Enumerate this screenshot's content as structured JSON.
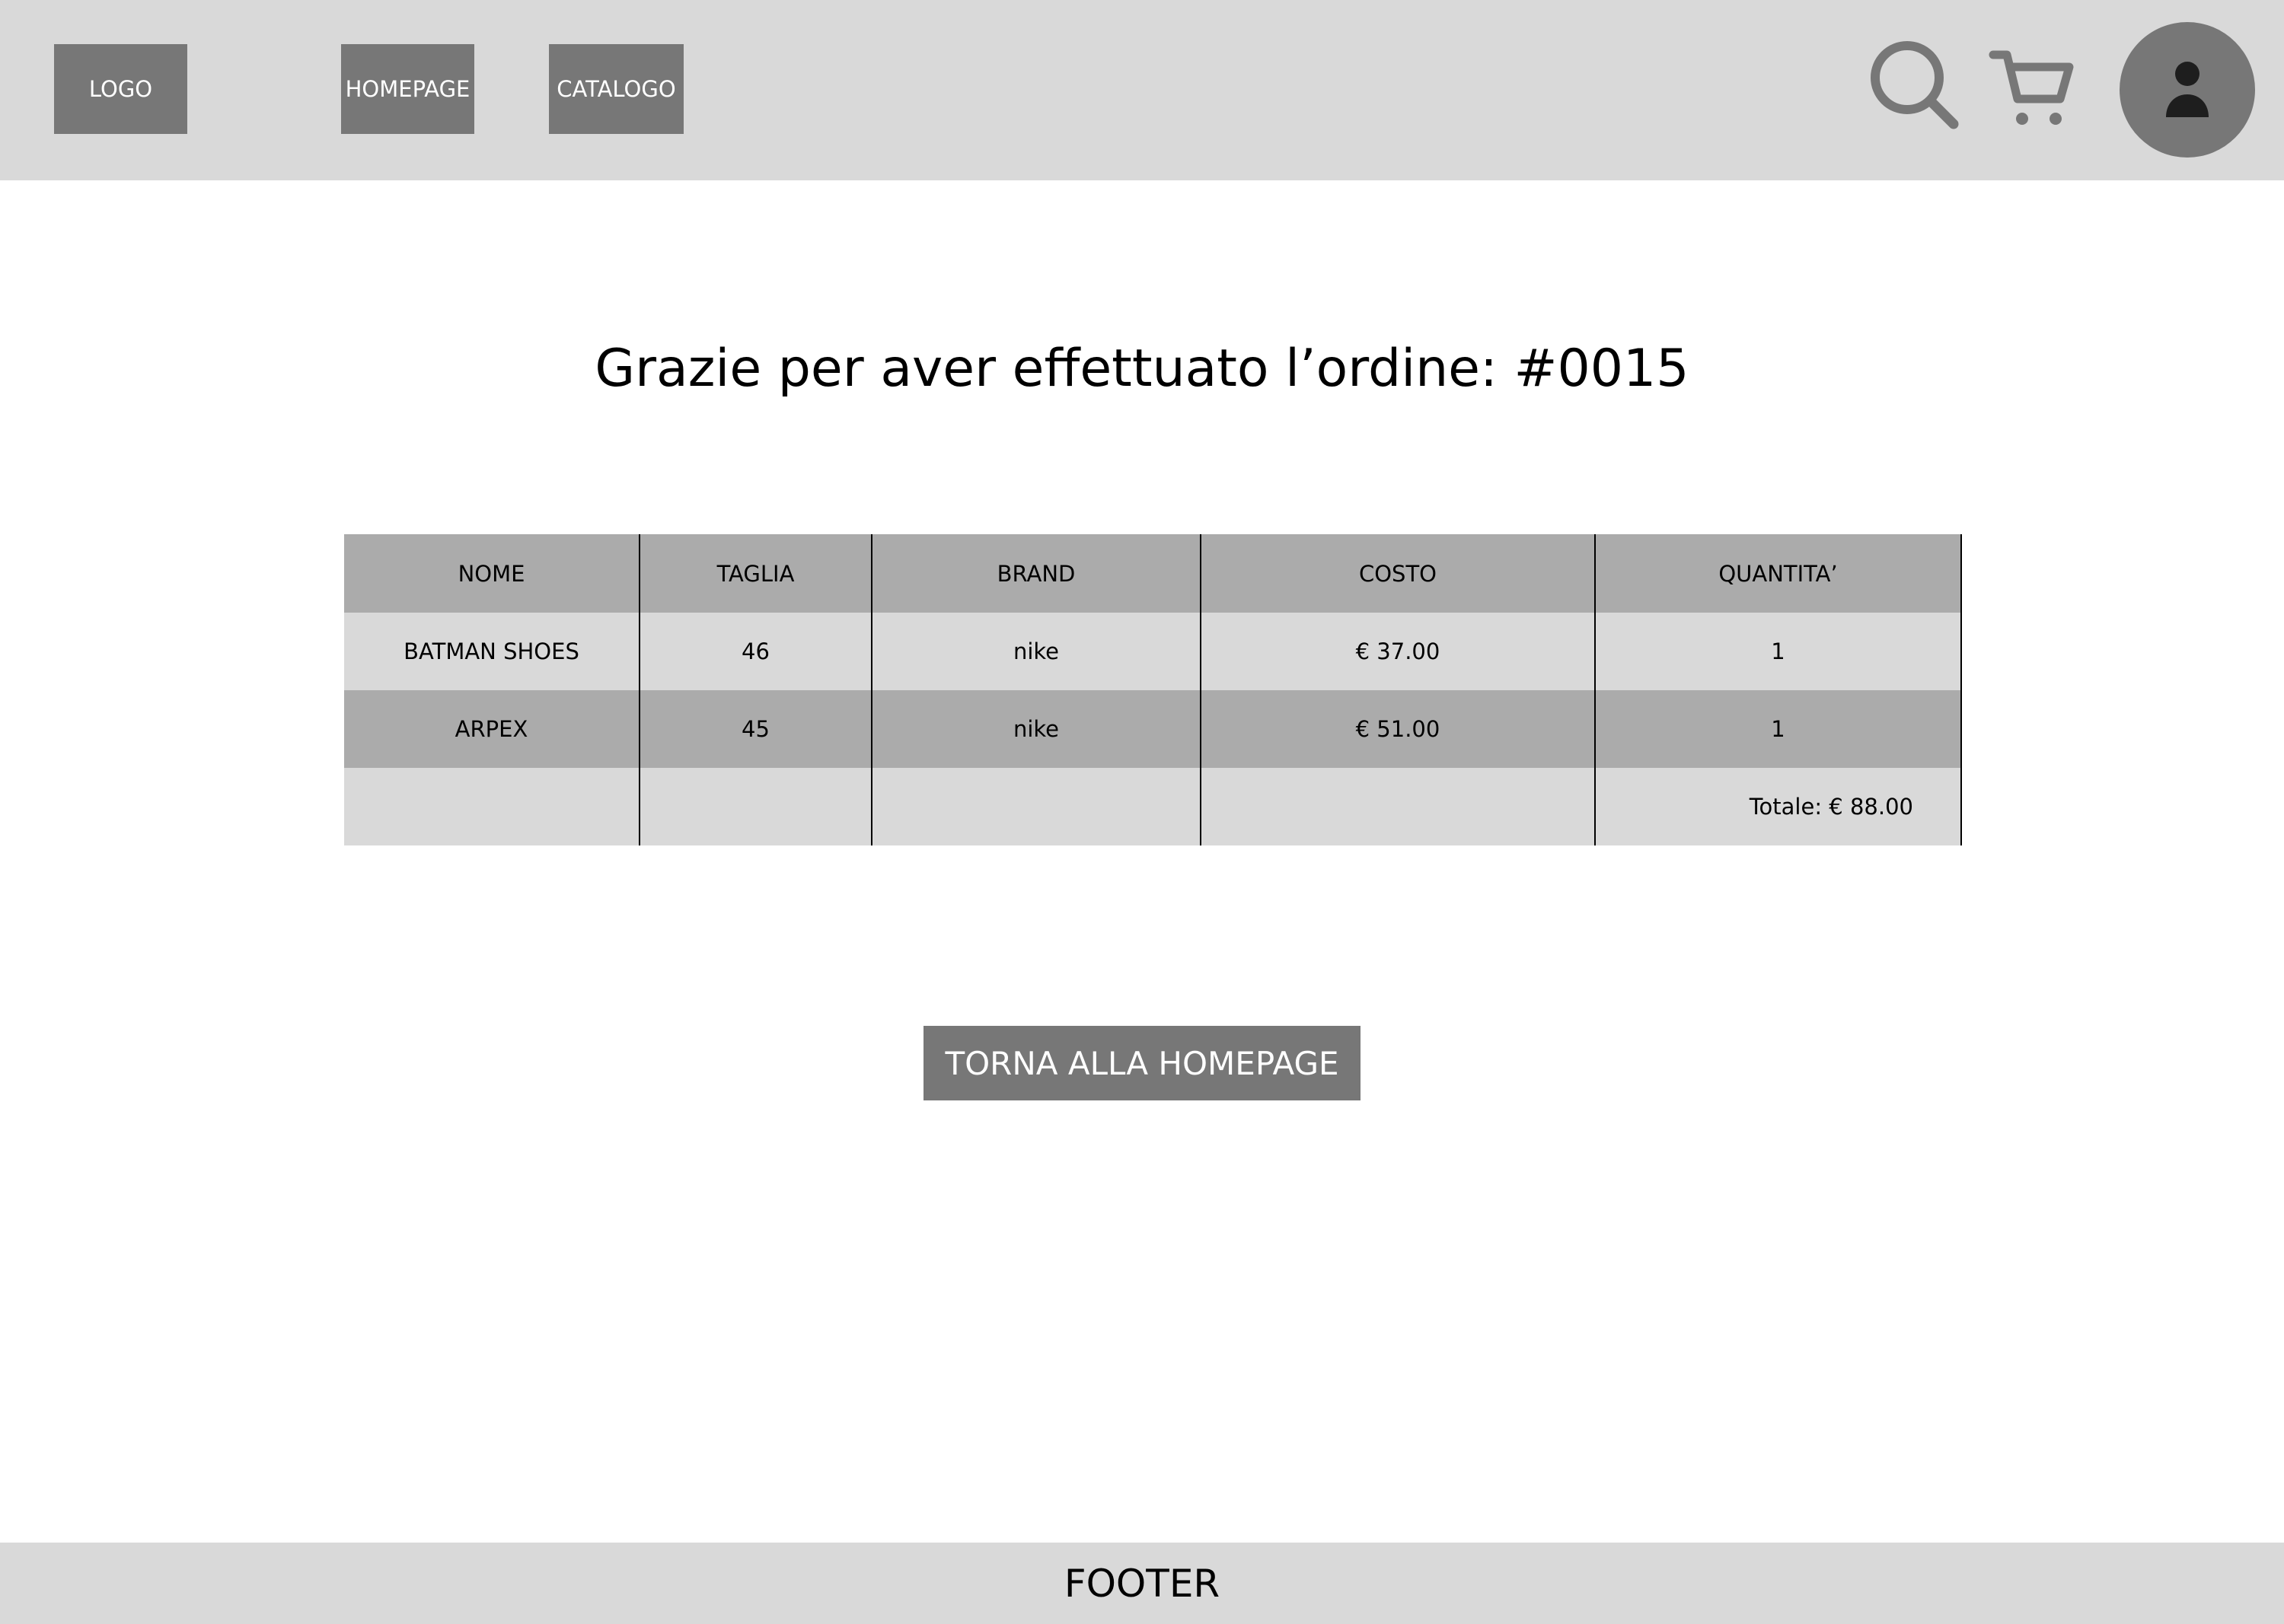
{
  "header": {
    "logo": "LOGO",
    "nav": [
      {
        "label": "HOMEPAGE"
      },
      {
        "label": "CATALOGO"
      }
    ],
    "icons": [
      "search-icon",
      "cart-icon",
      "user-avatar-icon"
    ]
  },
  "main": {
    "title": "Grazie per aver effettuato l’ordine: #0015",
    "table": {
      "headers": [
        "NOME",
        "TAGLIA",
        "BRAND",
        "COSTO",
        "QUANTITA’"
      ],
      "rows": [
        [
          "BATMAN SHOES",
          "46",
          "nike",
          "€ 37.00",
          "1"
        ],
        [
          "ARPEX",
          "45",
          "nike",
          "€ 51.00",
          "1"
        ]
      ],
      "total": "Totale: € 88.00"
    },
    "button": "TORNA ALLA HOMEPAGE"
  },
  "footer": {
    "label": "FOOTER"
  },
  "colors": {
    "header_bg": "#d9d9d9",
    "box_bg": "#777777",
    "table_header_bg": "#ababab",
    "table_light_bg": "#d9d9d9"
  }
}
